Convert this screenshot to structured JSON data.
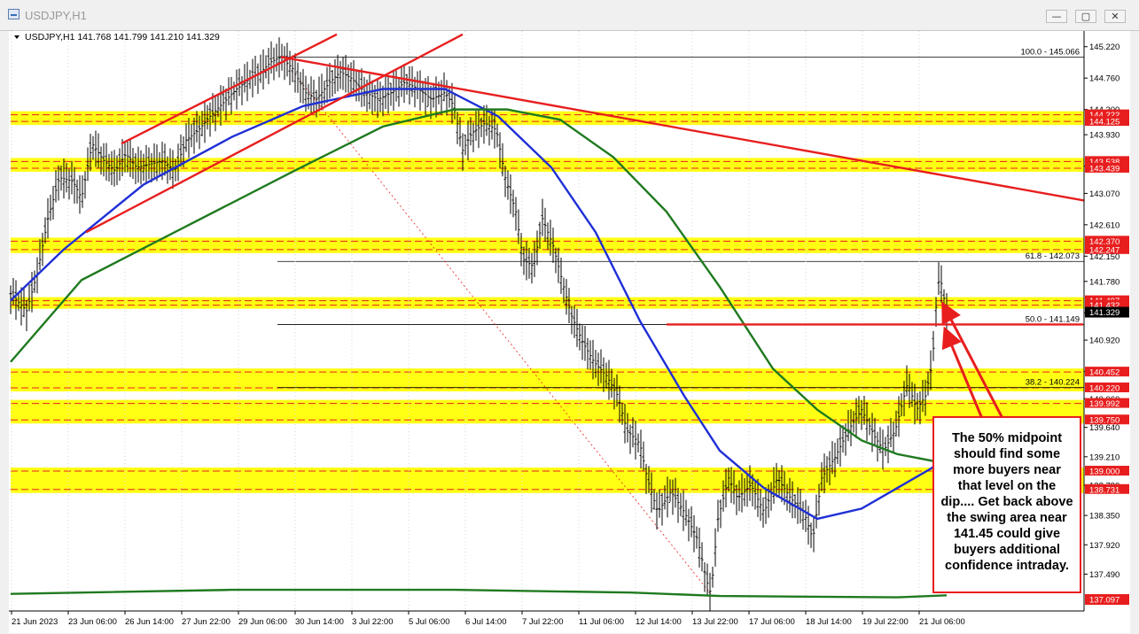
{
  "window": {
    "title": "USDJPY,H1",
    "controls": {
      "minimize": "—",
      "maximize": "▢",
      "close": "✕"
    }
  },
  "chart_data": {
    "type": "candlestick",
    "symbol": "USDJPY,H1",
    "ohlc_header": "USDJPY,H1  141.768 141.799 141.210 141.329",
    "ylim": [
      136.95,
      145.45
    ],
    "y_ticks": [
      145.22,
      144.76,
      144.3,
      143.93,
      143.47,
      143.07,
      142.61,
      142.15,
      141.78,
      141.32,
      140.92,
      140.46,
      140.06,
      139.64,
      139.21,
      138.79,
      138.35,
      137.92,
      137.49
    ],
    "y_tick_labels": [
      "145.220",
      "144.760",
      "144.300",
      "143.930",
      "143.470",
      "143.070",
      "142.610",
      "142.150",
      "141.780",
      "141.320",
      "140.920",
      "140.460",
      "140.060",
      "139.640",
      "139.210",
      "138.790",
      "138.350",
      "137.920",
      "137.490"
    ],
    "x_labels": [
      "21 Jun 2023",
      "23 Jun 06:00",
      "26 Jun 14:00",
      "27 Jun 22:00",
      "29 Jun 06:00",
      "30 Jun 14:00",
      "3 Jul 22:00",
      "5 Jul 06:00",
      "6 Jul 14:00",
      "7 Jul 22:00",
      "11 Jul 06:00",
      "12 Jul 14:00",
      "13 Jul 22:00",
      "17 Jul 06:00",
      "18 Jul 14:00",
      "19 Jul 22:00",
      "21 Jul 06:00"
    ],
    "current_price": 141.329,
    "current_price_label": "141.329",
    "fibonacci": [
      {
        "label": "100.0 - 145.066",
        "value": 145.066
      },
      {
        "label": "61.8 - 142.073",
        "value": 142.073
      },
      {
        "label": "50.0 - 141.149",
        "value": 141.149
      },
      {
        "label": "38.2 - 140.224",
        "value": 140.224
      }
    ],
    "zones": [
      {
        "from": 144.125,
        "to": 144.222,
        "labels": [
          "144.222",
          "144.125"
        ]
      },
      {
        "from": 143.439,
        "to": 143.538,
        "labels": [
          "143.538",
          "143.439"
        ]
      },
      {
        "from": 142.247,
        "to": 142.37,
        "labels": [
          "142.370",
          "142.247"
        ]
      },
      {
        "from": 141.432,
        "to": 141.497,
        "labels": [
          "141.497",
          "141.432"
        ]
      },
      {
        "from": 140.22,
        "to": 140.452,
        "labels": [
          "140.452",
          "140.220"
        ]
      },
      {
        "from": 139.75,
        "to": 139.992,
        "labels": [
          "139.992",
          "139.750"
        ]
      },
      {
        "from": 138.731,
        "to": 139.0,
        "labels": [
          "139.000",
          "138.731"
        ]
      }
    ],
    "bottom_right_label": "137.097",
    "price_path": [
      [
        0,
        141.6
      ],
      [
        18,
        141.35
      ],
      [
        30,
        141.9
      ],
      [
        42,
        142.7
      ],
      [
        55,
        143.3
      ],
      [
        70,
        143.25
      ],
      [
        80,
        143.0
      ],
      [
        92,
        143.8
      ],
      [
        105,
        143.55
      ],
      [
        118,
        143.4
      ],
      [
        130,
        143.65
      ],
      [
        142,
        143.45
      ],
      [
        158,
        143.5
      ],
      [
        172,
        143.55
      ],
      [
        185,
        143.4
      ],
      [
        198,
        143.85
      ],
      [
        212,
        144.0
      ],
      [
        225,
        144.2
      ],
      [
        240,
        144.4
      ],
      [
        255,
        144.6
      ],
      [
        270,
        144.75
      ],
      [
        282,
        144.85
      ],
      [
        294,
        145.0
      ],
      [
        305,
        145.07
      ],
      [
        318,
        144.9
      ],
      [
        332,
        144.55
      ],
      [
        345,
        144.45
      ],
      [
        360,
        144.7
      ],
      [
        372,
        144.85
      ],
      [
        385,
        144.75
      ],
      [
        400,
        144.55
      ],
      [
        415,
        144.45
      ],
      [
        430,
        144.55
      ],
      [
        445,
        144.7
      ],
      [
        460,
        144.6
      ],
      [
        475,
        144.45
      ],
      [
        490,
        144.55
      ],
      [
        500,
        144.35
      ],
      [
        510,
        143.7
      ],
      [
        520,
        143.95
      ],
      [
        535,
        144.1
      ],
      [
        548,
        144.0
      ],
      [
        558,
        143.3
      ],
      [
        570,
        142.8
      ],
      [
        578,
        142.1
      ],
      [
        590,
        142.0
      ],
      [
        600,
        142.7
      ],
      [
        612,
        142.3
      ],
      [
        622,
        141.8
      ],
      [
        632,
        141.3
      ],
      [
        645,
        140.9
      ],
      [
        658,
        140.6
      ],
      [
        672,
        140.4
      ],
      [
        685,
        140.1
      ],
      [
        695,
        139.6
      ],
      [
        710,
        139.4
      ],
      [
        718,
        138.9
      ],
      [
        730,
        138.4
      ],
      [
        745,
        138.7
      ],
      [
        760,
        138.4
      ],
      [
        775,
        138.0
      ],
      [
        785,
        137.4
      ],
      [
        790,
        137.2
      ],
      [
        798,
        138.3
      ],
      [
        810,
        138.9
      ],
      [
        820,
        138.6
      ],
      [
        835,
        138.8
      ],
      [
        850,
        138.4
      ],
      [
        865,
        138.9
      ],
      [
        880,
        138.6
      ],
      [
        895,
        138.4
      ],
      [
        905,
        138.0
      ],
      [
        915,
        138.9
      ],
      [
        930,
        139.2
      ],
      [
        945,
        139.6
      ],
      [
        960,
        139.9
      ],
      [
        975,
        139.5
      ],
      [
        985,
        139.3
      ],
      [
        998,
        139.6
      ],
      [
        1012,
        140.3
      ],
      [
        1022,
        139.9
      ],
      [
        1032,
        140.1
      ],
      [
        1040,
        140.6
      ],
      [
        1044,
        141.4
      ],
      [
        1048,
        141.9
      ],
      [
        1052,
        141.6
      ],
      [
        1056,
        141.33
      ]
    ],
    "moving_averages": [
      {
        "color": "#1f2fd6",
        "points": [
          [
            0,
            141.5
          ],
          [
            60,
            142.25
          ],
          [
            150,
            143.2
          ],
          [
            250,
            143.9
          ],
          [
            330,
            144.35
          ],
          [
            420,
            144.6
          ],
          [
            490,
            144.6
          ],
          [
            550,
            144.2
          ],
          [
            610,
            143.45
          ],
          [
            660,
            142.5
          ],
          [
            710,
            141.2
          ],
          [
            760,
            140.1
          ],
          [
            800,
            139.3
          ],
          [
            850,
            138.75
          ],
          [
            910,
            138.3
          ],
          [
            960,
            138.45
          ],
          [
            1000,
            138.75
          ],
          [
            1040,
            139.05
          ],
          [
            1056,
            139.35
          ]
        ]
      },
      {
        "color": "#1f7a1f",
        "points": [
          [
            0,
            140.6
          ],
          [
            80,
            141.8
          ],
          [
            200,
            142.6
          ],
          [
            320,
            143.4
          ],
          [
            420,
            144.05
          ],
          [
            500,
            144.3
          ],
          [
            560,
            144.3
          ],
          [
            620,
            144.15
          ],
          [
            680,
            143.6
          ],
          [
            740,
            142.8
          ],
          [
            800,
            141.7
          ],
          [
            860,
            140.5
          ],
          [
            910,
            139.9
          ],
          [
            960,
            139.45
          ],
          [
            1000,
            139.25
          ],
          [
            1040,
            139.15
          ],
          [
            1056,
            139.2
          ]
        ]
      },
      {
        "color": "#1f7a1f",
        "points": [
          [
            0,
            137.2
          ],
          [
            250,
            137.26
          ],
          [
            500,
            137.26
          ],
          [
            700,
            137.22
          ],
          [
            800,
            137.17
          ],
          [
            1000,
            137.15
          ],
          [
            1056,
            137.18
          ]
        ]
      }
    ],
    "trendlines": [
      {
        "color": "#e81e1e",
        "points": [
          [
            85,
            142.5
          ],
          [
            510,
            145.4
          ]
        ]
      },
      {
        "color": "#e81e1e",
        "points": [
          [
            125,
            143.8
          ],
          [
            368,
            145.4
          ]
        ]
      },
      {
        "color": "#e81e1e",
        "points": [
          [
            305,
            145.07
          ],
          [
            1218,
            142.95
          ]
        ]
      },
      {
        "color": "#e81e1e",
        "points": [
          [
            740,
            141.149
          ],
          [
            1210,
            141.149
          ]
        ]
      }
    ],
    "arrows": [
      {
        "from": [
          1118,
          139.8
        ],
        "to": [
          1053,
          141.42
        ]
      },
      {
        "from": [
          1095,
          139.8
        ],
        "to": [
          1055,
          141.05
        ]
      }
    ],
    "annotation": "The 50% midpoint should find some more buyers near that level on the dip.... Get back above the swing area near 141.45 could give buyers additional confidence intraday."
  }
}
